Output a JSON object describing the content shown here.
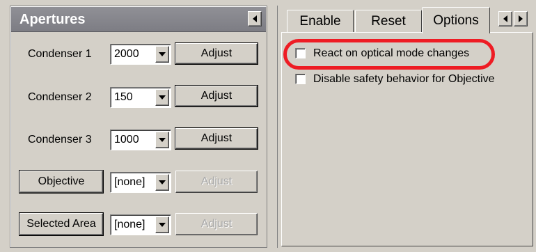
{
  "apertures_panel": {
    "title": "Apertures",
    "rows": [
      {
        "label": "Condenser 1",
        "value": "2000",
        "button": "Adjust"
      },
      {
        "label": "Condenser 2",
        "value": "150",
        "button": "Adjust"
      },
      {
        "label": "Condenser 3",
        "value": "1000",
        "button": "Adjust"
      },
      {
        "label": "Objective",
        "value": "[none]",
        "button": "Adjust"
      },
      {
        "label": "Selected Area",
        "value": "[none]",
        "button": "Adjust"
      }
    ]
  },
  "options_panel": {
    "tabs": [
      {
        "label": "Enable"
      },
      {
        "label": "Reset"
      },
      {
        "label": "Options"
      }
    ],
    "active_tab": "Options",
    "checkboxes": [
      {
        "label": "React on optical mode changes",
        "checked": false,
        "highlighted": true
      },
      {
        "label": "Disable safety behavior for Objective",
        "checked": false,
        "highlighted": false
      }
    ]
  },
  "colors": {
    "highlight": "#ee1c24",
    "header": "#858589",
    "face": "#d4d0c8"
  }
}
